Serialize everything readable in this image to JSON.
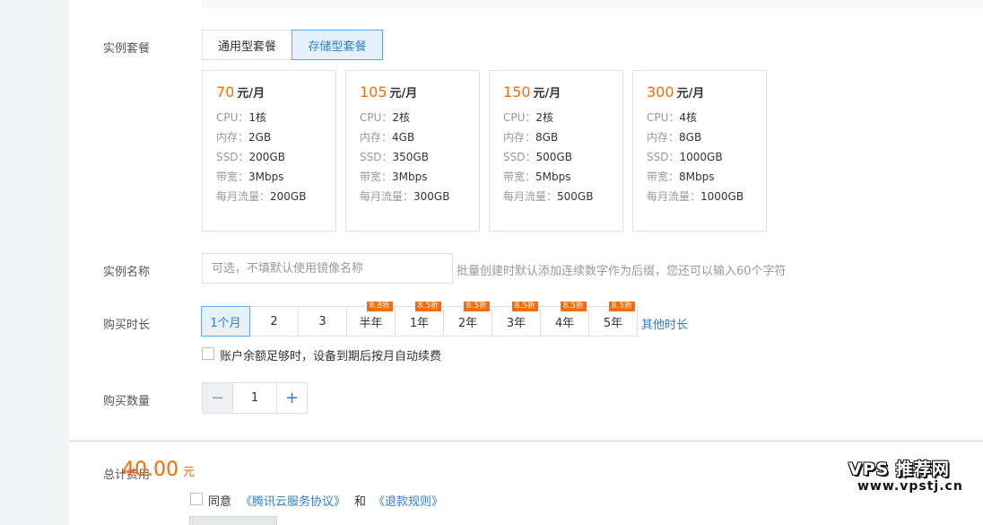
{
  "labels": {
    "plan": "实例套餐",
    "name": "实例名称",
    "duration": "购买时长",
    "quantity": "购买数量",
    "total": "总计费用"
  },
  "plan_tabs": [
    {
      "label": "通用型套餐",
      "active": false
    },
    {
      "label": "存储型套餐",
      "active": true
    }
  ],
  "plans": [
    {
      "price": "70",
      "unit": "元/月",
      "specs": [
        {
          "k": "CPU：",
          "v": "1核"
        },
        {
          "k": "内存：",
          "v": "2GB"
        },
        {
          "k": "SSD：",
          "v": "200GB"
        },
        {
          "k": "带宽：",
          "v": "3Mbps"
        },
        {
          "k": "每月流量：",
          "v": "200GB"
        }
      ]
    },
    {
      "price": "105",
      "unit": "元/月",
      "specs": [
        {
          "k": "CPU：",
          "v": "2核"
        },
        {
          "k": "内存：",
          "v": "4GB"
        },
        {
          "k": "SSD：",
          "v": "350GB"
        },
        {
          "k": "带宽：",
          "v": "3Mbps"
        },
        {
          "k": "每月流量：",
          "v": "300GB"
        }
      ]
    },
    {
      "price": "150",
      "unit": "元/月",
      "specs": [
        {
          "k": "CPU：",
          "v": "2核"
        },
        {
          "k": "内存：",
          "v": "8GB"
        },
        {
          "k": "SSD：",
          "v": "500GB"
        },
        {
          "k": "带宽：",
          "v": "5Mbps"
        },
        {
          "k": "每月流量：",
          "v": "500GB"
        }
      ]
    },
    {
      "price": "300",
      "unit": "元/月",
      "specs": [
        {
          "k": "CPU：",
          "v": "4核"
        },
        {
          "k": "内存：",
          "v": "8GB"
        },
        {
          "k": "SSD：",
          "v": "1000GB"
        },
        {
          "k": "带宽：",
          "v": "8Mbps"
        },
        {
          "k": "每月流量：",
          "v": "1000GB"
        }
      ]
    }
  ],
  "name_input": {
    "placeholder": "可选，不填默认使用镜像名称",
    "hint": "批量创建时默认添加连续数字作为后缀，您还可以输入60个字符"
  },
  "durations": [
    {
      "label": "1个月",
      "badge": "",
      "active": true
    },
    {
      "label": "2",
      "badge": ""
    },
    {
      "label": "3",
      "badge": ""
    },
    {
      "label": "半年",
      "badge": "8.8折"
    },
    {
      "label": "1年",
      "badge": "8.5折"
    },
    {
      "label": "2年",
      "badge": "8.5折"
    },
    {
      "label": "3年",
      "badge": "8.5折"
    },
    {
      "label": "4年",
      "badge": "8.5折"
    },
    {
      "label": "5年",
      "badge": "8.5折"
    }
  ],
  "other_duration": "其他时长",
  "auto_renew": "账户余额足够时，设备到期后按月自动续费",
  "quantity": {
    "minus": "−",
    "value": "1",
    "plus": "+"
  },
  "total": {
    "amount": "40.00",
    "unit": "元"
  },
  "agreement": {
    "agree": "同意",
    "service": "《腾讯云服务协议》",
    "and": "和",
    "refund": "《退款规则》"
  },
  "watermark": {
    "line1": "VPS 推荐网",
    "line2": "www.vpstj.cn"
  },
  "colors": {
    "accent": "#2f7fd4",
    "price": "#ff6a00",
    "border": "#dcdfe6"
  }
}
